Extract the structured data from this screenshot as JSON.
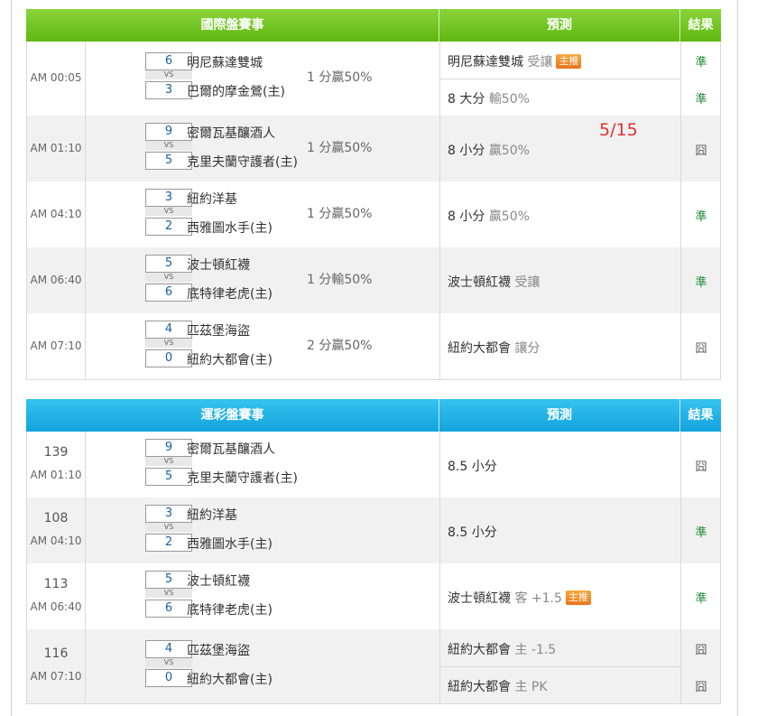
{
  "annotation": "5/15",
  "intl": {
    "headers": {
      "event": "國際盤賽事",
      "pred": "預測",
      "result": "結果"
    },
    "rows": [
      {
        "time": "AM 00:05",
        "s1": "6",
        "s2": "3",
        "t1": "明尼蘇達雙城",
        "t2": "巴爾的摩金鶯(主)",
        "line": "1 分贏50%",
        "preds": [
          {
            "main": "明尼蘇達雙城",
            "sub": "受讓",
            "badge": "主推",
            "result": "準"
          },
          {
            "main": "8 大分",
            "sub": "輸50%",
            "result": "準"
          }
        ]
      },
      {
        "time": "AM 01:10",
        "s1": "9",
        "s2": "5",
        "t1": "密爾瓦基釀酒人",
        "t2": "克里夫蘭守護者(主)",
        "line": "1 分贏50%",
        "preds": [
          {
            "main": "8 小分",
            "sub": "贏50%",
            "result": "囧"
          }
        ]
      },
      {
        "time": "AM 04:10",
        "s1": "3",
        "s2": "2",
        "t1": "紐約洋基",
        "t2": "西雅圖水手(主)",
        "line": "1 分贏50%",
        "preds": [
          {
            "main": "8 小分",
            "sub": "贏50%",
            "result": "準"
          }
        ]
      },
      {
        "time": "AM 06:40",
        "s1": "5",
        "s2": "6",
        "t1": "波士頓紅襪",
        "t2": "底特律老虎(主)",
        "line": "1 分輸50%",
        "preds": [
          {
            "main": "波士頓紅襪",
            "sub": "受讓",
            "result": "準"
          }
        ]
      },
      {
        "time": "AM 07:10",
        "s1": "4",
        "s2": "0",
        "t1": "匹茲堡海盜",
        "t2": "紐約大都會(主)",
        "line": "2 分贏50%",
        "preds": [
          {
            "main": "紐約大都會",
            "sub": "讓分",
            "result": "囧"
          }
        ]
      }
    ]
  },
  "sport": {
    "headers": {
      "event": "運彩盤賽事",
      "pred": "預測",
      "result": "結果"
    },
    "rows": [
      {
        "num": "139",
        "time": "AM 01:10",
        "s1": "9",
        "s2": "5",
        "t1": "密爾瓦基釀酒人",
        "t2": "克里夫蘭守護者(主)",
        "preds": [
          {
            "main": "8.5 小分",
            "sub": "",
            "result": "囧"
          }
        ]
      },
      {
        "num": "108",
        "time": "AM 04:10",
        "s1": "3",
        "s2": "2",
        "t1": "紐約洋基",
        "t2": "西雅圖水手(主)",
        "preds": [
          {
            "main": "8.5 小分",
            "sub": "",
            "result": "準"
          }
        ]
      },
      {
        "num": "113",
        "time": "AM 06:40",
        "s1": "5",
        "s2": "6",
        "t1": "波士頓紅襪",
        "t2": "底特律老虎(主)",
        "preds": [
          {
            "main": "波士頓紅襪",
            "sub": "客 +1.5",
            "badge": "主推",
            "result": "準"
          }
        ]
      },
      {
        "num": "116",
        "time": "AM 07:10",
        "s1": "4",
        "s2": "0",
        "t1": "匹茲堡海盜",
        "t2": "紐約大都會(主)",
        "preds": [
          {
            "main": "紐約大都會",
            "sub": "主 -1.5",
            "result": "囧"
          },
          {
            "main": "紐約大都會",
            "sub": "主 PK",
            "result": "囧"
          }
        ]
      }
    ]
  },
  "vs_label": "VS"
}
